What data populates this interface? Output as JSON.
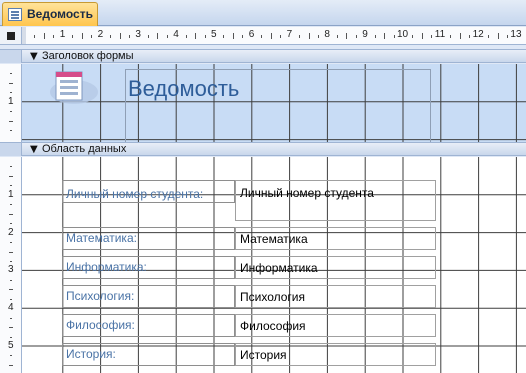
{
  "tab": {
    "title": "Ведомость"
  },
  "ruler": {
    "numbers": [
      "1",
      "2",
      "3",
      "4",
      "5",
      "6",
      "7",
      "8",
      "9",
      "10",
      "11",
      "12",
      "13"
    ]
  },
  "vruler_header": {
    "numbers": [
      "1"
    ]
  },
  "vruler_data": {
    "numbers": [
      "1",
      "2",
      "3",
      "4",
      "5"
    ]
  },
  "sections": {
    "header": "Заголовок формы",
    "detail": "Область данных"
  },
  "form_header": {
    "title": "Ведомость"
  },
  "fields": [
    {
      "label": "Личный номер студента:",
      "value": "Личный номер студента"
    },
    {
      "label": "Математика:",
      "value": "Математика"
    },
    {
      "label": "Информатика:",
      "value": "Информатика"
    },
    {
      "label": "Психология:",
      "value": "Психология"
    },
    {
      "label": "Философия:",
      "value": "Философия"
    },
    {
      "label": "История:",
      "value": "История"
    }
  ]
}
